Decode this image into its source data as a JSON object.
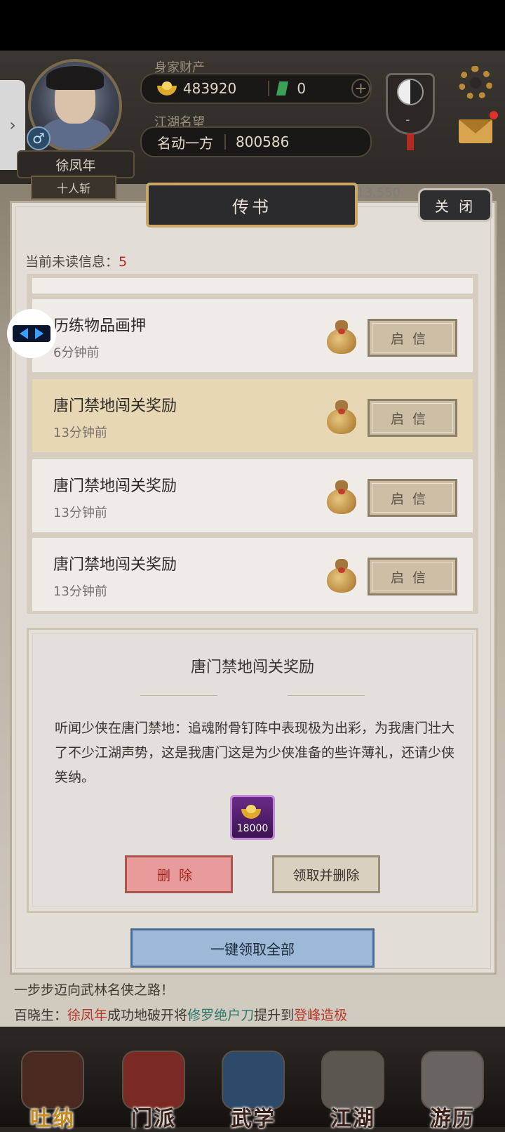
{
  "header": {
    "assets_label": "身家财产",
    "gold": "483920",
    "jade": "0",
    "fame_label": "江湖名望",
    "fame_title": "名动一方",
    "fame_value": "800586",
    "player_name": "徐凤年",
    "rank": "十人斩",
    "side_value": "13,550"
  },
  "dialog": {
    "title": "传书",
    "close_label": "关 闭",
    "unread_label": "当前未读信息：",
    "unread_count": "5",
    "open_label": "启信",
    "messages": [
      {
        "title": "历练物品画押",
        "time": "6分钟前"
      },
      {
        "title": "唐门禁地闯关奖励",
        "time": "13分钟前"
      },
      {
        "title": "唐门禁地闯关奖励",
        "time": "13分钟前"
      },
      {
        "title": "唐门禁地闯关奖励",
        "time": "13分钟前"
      }
    ],
    "detail": {
      "title": "唐门禁地闯关奖励",
      "body": "听闻少侠在唐门禁地：追魂附骨钉阵中表现极为出彩，为我唐门壮大了不少江湖声势，这是我唐门这是为少侠准备的些许薄礼，还请少侠笑纳。",
      "reward_amount": "18000",
      "delete_label": "删除",
      "claim_label": "领取并删除"
    },
    "claim_all_label": "一键领取全部"
  },
  "log": {
    "line1": "一步步迈向武林名侠之路！",
    "line2_a": "百晓生：",
    "line2_b": "徐凤年",
    "line2_c": "成功地破开",
    "line2_d": "将",
    "line2_e": "修罗绝户刀",
    "line2_f": "提升到",
    "line2_g": "登峰造极"
  },
  "nav": {
    "items": [
      "吐纳",
      "门派",
      "武学",
      "江湖",
      "游历"
    ]
  },
  "colors": {
    "accent_red": "#b02a22",
    "panel_bg": "#e2ddd6",
    "selected_row": "#e7d7b5"
  }
}
